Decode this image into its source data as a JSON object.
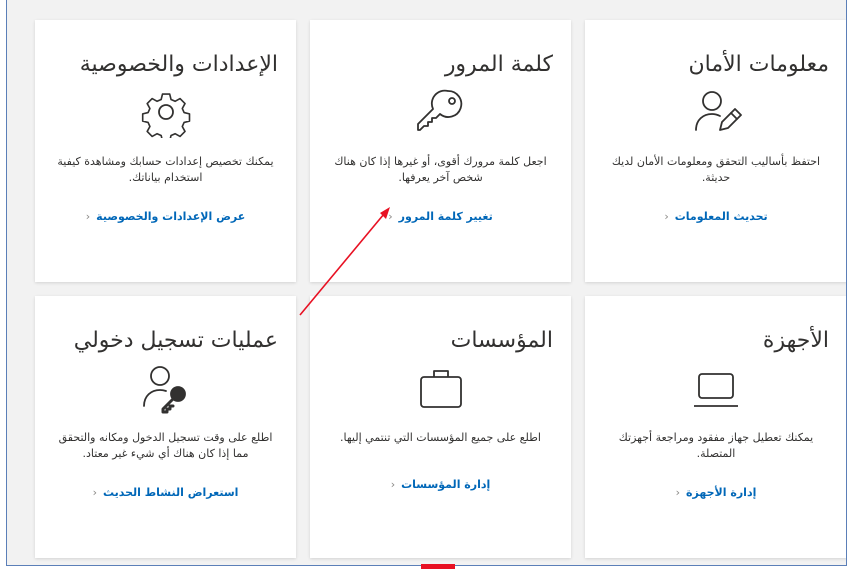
{
  "cards": [
    {
      "title": "الإعدادات والخصوصية",
      "icon": "gear-icon",
      "description": "يمكنك تخصيص إعدادات حسابك ومشاهدة كيفية استخدام بياناتك.",
      "link": "عرض الإعدادات والخصوصية"
    },
    {
      "title": "كلمة المرور",
      "icon": "key-icon",
      "description": "اجعل كلمة مرورك أقوى، أو غيرها إذا كان هناك شخص آخر يعرفها.",
      "link": "تغيير كلمة المرور"
    },
    {
      "title": "معلومات الأمان",
      "icon": "user-edit-icon",
      "description": "احتفظ بأساليب التحقق ومعلومات الأمان لديك حديثة.",
      "link": "تحديث المعلومات"
    },
    {
      "title": "عمليات تسجيل دخولي",
      "icon": "user-key-icon",
      "description": "اطلع على وقت تسجيل الدخول ومكانه والتحقق مما إذا كان هناك أي شيء غير معتاد.",
      "link": "استعراض النشاط الحديث"
    },
    {
      "title": "المؤسسات",
      "icon": "briefcase-icon",
      "description": "اطلع على جميع المؤسسات التي تنتمي إليها.",
      "link": "إدارة المؤسسات"
    },
    {
      "title": "الأجهزة",
      "icon": "laptop-icon",
      "description": "يمكنك تعطيل جهاز مفقود ومراجعة أجهزتك المتصلة.",
      "link": "إدارة الأجهزة"
    }
  ],
  "link_chevron": "‹",
  "colors": {
    "accent_link": "#0067b8",
    "annotation_arrow": "#e81123",
    "frame_border": "#5b7fb8",
    "background": "#f2f2f2"
  }
}
